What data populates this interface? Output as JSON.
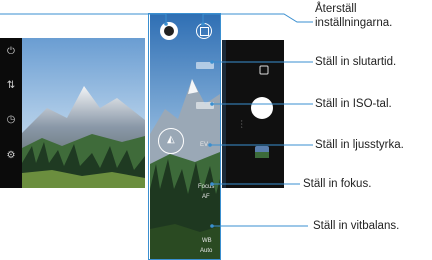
{
  "callouts": {
    "reset": "Återställ\ninställningarna.",
    "reset_line1": "Återställ",
    "reset_line2": "inställningarna.",
    "shutter": "Ställ in slutartid.",
    "iso": "Ställ in ISO-tal.",
    "brightness": "Ställ in ljusstyrka.",
    "focus": "Ställ in fokus.",
    "white_balance": "Ställ in vitbalans."
  },
  "camera": {
    "focus_label": "Focus",
    "focus_value": "AF",
    "wb_label": "WB",
    "wb_value": "Auto",
    "ev_label": "EV"
  },
  "colors": {
    "callout_line": "#3a8fd0",
    "frame": "#3a8fd0"
  }
}
